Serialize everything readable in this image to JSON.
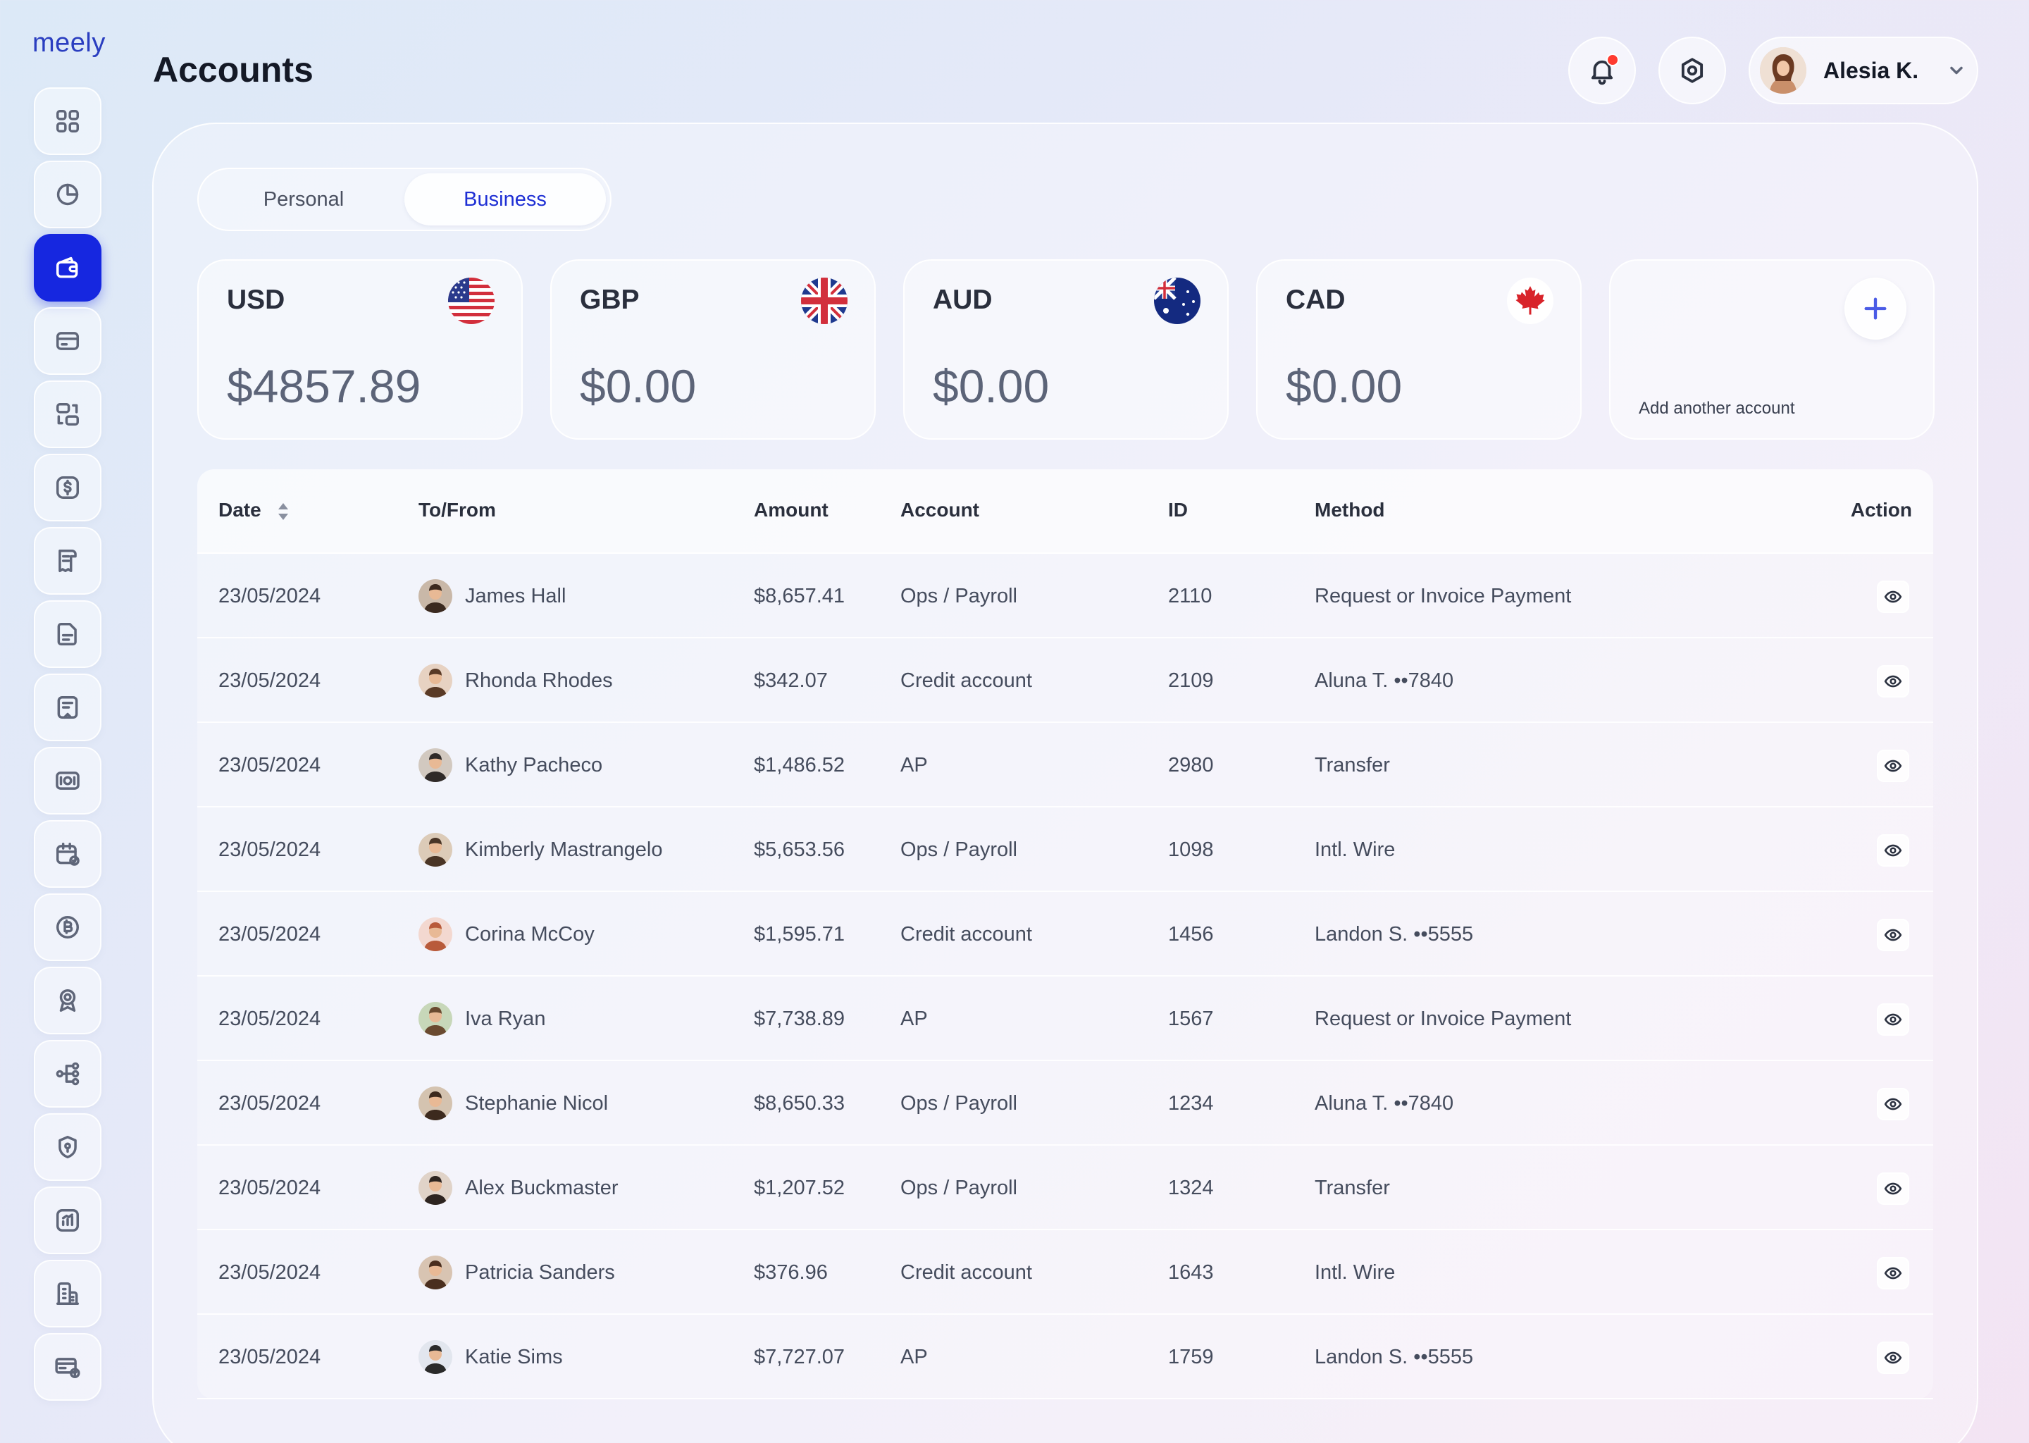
{
  "app": {
    "logo": "meely"
  },
  "header": {
    "title": "Accounts",
    "notification_icon": "bell-icon",
    "settings_icon": "settings-hexagon-icon",
    "user": {
      "name": "Alesia K."
    }
  },
  "colors": {
    "accent": "#1627e0",
    "notification": "#ff3b30",
    "add_button": "#4a5be6"
  },
  "sidebar": {
    "items": [
      {
        "icon": "grid-icon"
      },
      {
        "icon": "pie-chart-icon"
      },
      {
        "icon": "wallet-icon",
        "active": true
      },
      {
        "icon": "card-icon"
      },
      {
        "icon": "exchange-icon"
      },
      {
        "icon": "dollar-icon"
      },
      {
        "icon": "document-icon"
      },
      {
        "icon": "file-icon"
      },
      {
        "icon": "receipt-icon"
      },
      {
        "icon": "banknote-icon"
      },
      {
        "icon": "calendar-check-icon"
      },
      {
        "icon": "bitcoin-icon"
      },
      {
        "icon": "badge-icon"
      },
      {
        "icon": "network-icon"
      },
      {
        "icon": "shield-icon"
      },
      {
        "icon": "report-icon"
      },
      {
        "icon": "building-icon"
      },
      {
        "icon": "payment-card-icon"
      }
    ]
  },
  "tabs": [
    {
      "label": "Personal",
      "active": false
    },
    {
      "label": "Business",
      "active": true
    }
  ],
  "accounts": [
    {
      "code": "USD",
      "amount": "$4857.89",
      "flag": "us-flag-icon"
    },
    {
      "code": "GBP",
      "amount": "$0.00",
      "flag": "uk-flag-icon"
    },
    {
      "code": "AUD",
      "amount": "$0.00",
      "flag": "au-flag-icon"
    },
    {
      "code": "CAD",
      "amount": "$0.00",
      "flag": "ca-flag-icon"
    }
  ],
  "add_account": {
    "label": "Add another account"
  },
  "table": {
    "columns": [
      "Date",
      "To/From",
      "Amount",
      "Account",
      "ID",
      "Method",
      "Action"
    ],
    "rows": [
      {
        "date": "23/05/2024",
        "name": "James Hall",
        "amount": "$8,657.41",
        "account": "Ops / Payroll",
        "id": "2110",
        "method": "Request or Invoice Payment"
      },
      {
        "date": "23/05/2024",
        "name": "Rhonda Rhodes",
        "amount": "$342.07",
        "account": "Credit account",
        "id": "2109",
        "method": "Aluna T. ••7840"
      },
      {
        "date": "23/05/2024",
        "name": "Kathy Pacheco",
        "amount": "$1,486.52",
        "account": "AP",
        "id": "2980",
        "method": "Transfer"
      },
      {
        "date": "23/05/2024",
        "name": "Kimberly Mastrangelo",
        "amount": "$5,653.56",
        "account": "Ops / Payroll",
        "id": "1098",
        "method": "Intl. Wire"
      },
      {
        "date": "23/05/2024",
        "name": "Corina McCoy",
        "amount": "$1,595.71",
        "account": "Credit account",
        "id": "1456",
        "method": "Landon S. ••5555"
      },
      {
        "date": "23/05/2024",
        "name": "Iva Ryan",
        "amount": "$7,738.89",
        "account": "AP",
        "id": "1567",
        "method": "Request or Invoice Payment"
      },
      {
        "date": "23/05/2024",
        "name": "Stephanie Nicol",
        "amount": "$8,650.33",
        "account": "Ops / Payroll",
        "id": "1234",
        "method": "Aluna T. ••7840"
      },
      {
        "date": "23/05/2024",
        "name": "Alex Buckmaster",
        "amount": "$1,207.52",
        "account": "Ops / Payroll",
        "id": "1324",
        "method": "Transfer"
      },
      {
        "date": "23/05/2024",
        "name": "Patricia Sanders",
        "amount": "$376.96",
        "account": "Credit account",
        "id": "1643",
        "method": "Intl. Wire"
      },
      {
        "date": "23/05/2024",
        "name": "Katie Sims",
        "amount": "$7,727.07",
        "account": "AP",
        "id": "1759",
        "method": "Landon S. ••5555"
      }
    ]
  }
}
